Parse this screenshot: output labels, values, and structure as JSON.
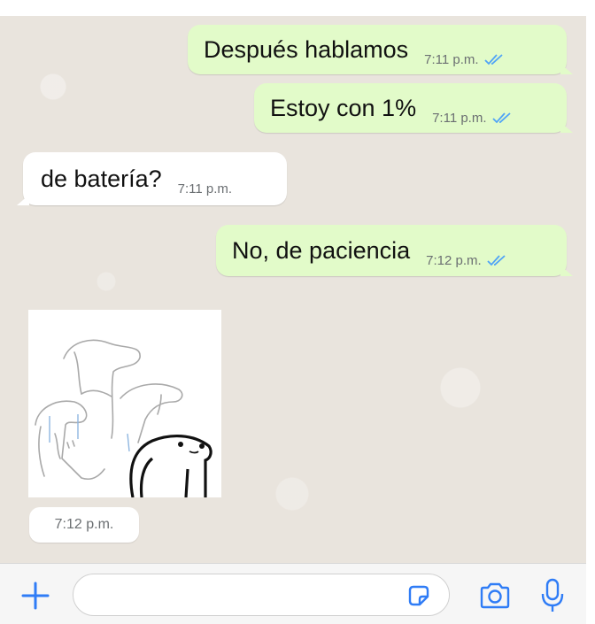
{
  "messages": [
    {
      "text": "Después hablamos",
      "time": "7:11 p.m.",
      "direction": "outgoing",
      "status": "read"
    },
    {
      "text": "Estoy con 1%",
      "time": "7:11 p.m.",
      "direction": "outgoing",
      "status": "read"
    },
    {
      "text": "de batería?",
      "time": "7:11 p.m.",
      "direction": "incoming"
    },
    {
      "text": "No, de paciencia",
      "time": "7:12 p.m.",
      "direction": "outgoing",
      "status": "read"
    },
    {
      "type": "sticker",
      "time": "7:12 p.m.",
      "direction": "incoming",
      "sticker_icon": "sketch-sticker"
    }
  ],
  "composer": {
    "input_value": "",
    "icons": [
      "plus-icon",
      "sticker-icon",
      "camera-icon",
      "microphone-icon"
    ]
  },
  "colors": {
    "chat_background": "#e9e4dd",
    "outgoing_bubble": "#e2fbc9",
    "incoming_bubble": "#ffffff",
    "accent": "#2f7cf6",
    "read_ticks": "#4fa3f7"
  }
}
